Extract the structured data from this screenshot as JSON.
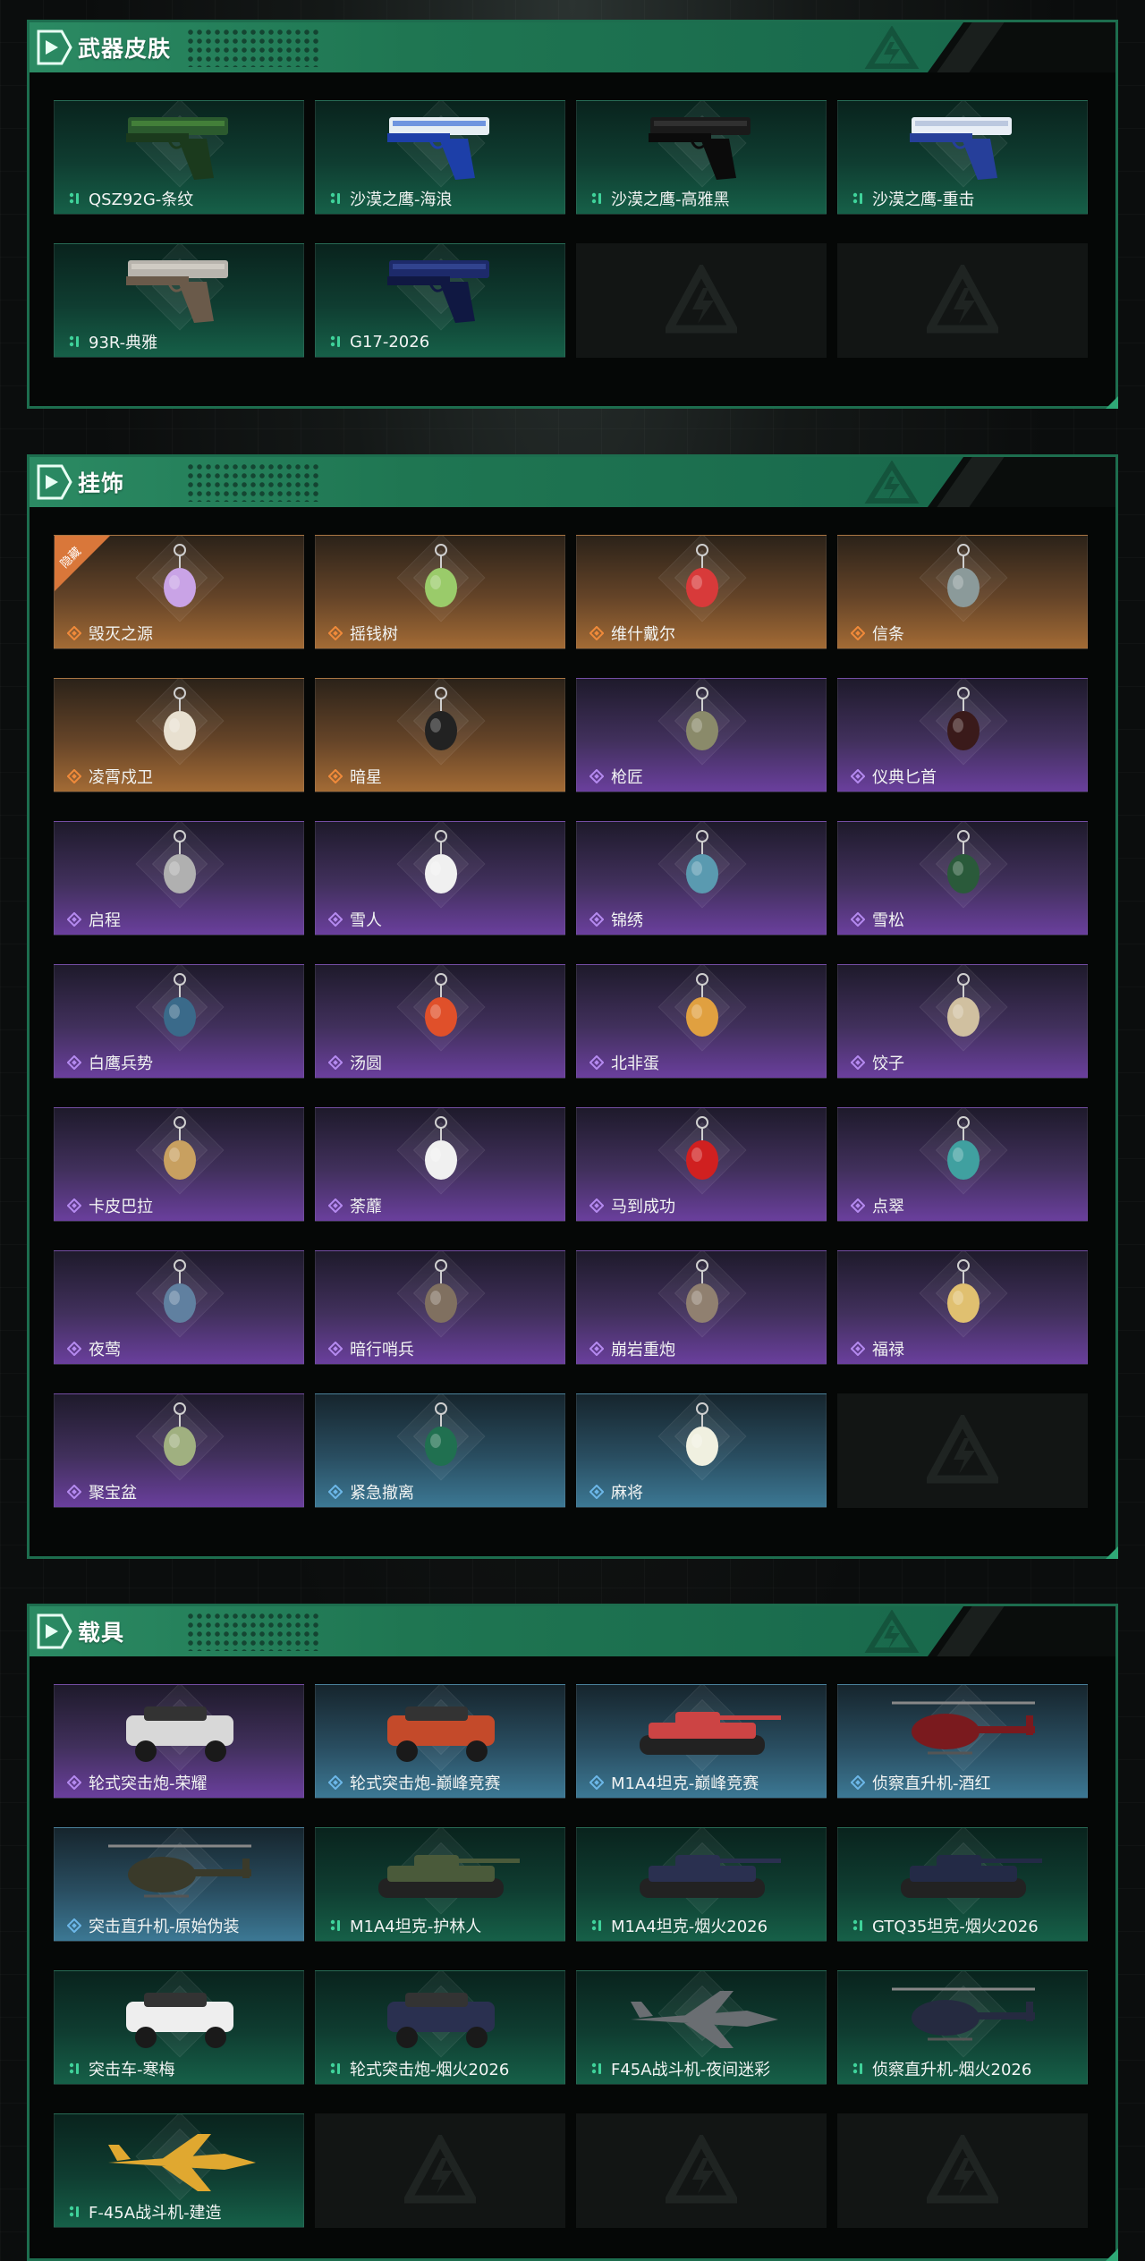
{
  "sections": {
    "weapons": {
      "title": "武器皮肤",
      "items": [
        {
          "label": "QSZ92G-条纹",
          "rarity": "green",
          "art": "pistol-green-camo"
        },
        {
          "label": "沙漠之鹰-海浪",
          "rarity": "green",
          "art": "pistol-blue-wave"
        },
        {
          "label": "沙漠之鹰-高雅黑",
          "rarity": "green",
          "art": "pistol-black"
        },
        {
          "label": "沙漠之鹰-重击",
          "rarity": "green",
          "art": "pistol-white-blue"
        },
        {
          "label": "93R-典雅",
          "rarity": "green",
          "art": "pistol-silver"
        },
        {
          "label": "G17-2026",
          "rarity": "green",
          "art": "pistol-navy"
        }
      ]
    },
    "charms": {
      "title": "挂饰",
      "hidden_badge": "隐藏",
      "items": [
        {
          "label": "毁灭之源",
          "rarity": "orange"
        },
        {
          "label": "摇钱树",
          "rarity": "orange"
        },
        {
          "label": "维什戴尔",
          "rarity": "orange"
        },
        {
          "label": "信条",
          "rarity": "orange"
        },
        {
          "label": "凌霄戍卫",
          "rarity": "orange"
        },
        {
          "label": "暗星",
          "rarity": "orange"
        },
        {
          "label": "枪匠",
          "rarity": "purple"
        },
        {
          "label": "仪典匕首",
          "rarity": "purple"
        },
        {
          "label": "启程",
          "rarity": "purple"
        },
        {
          "label": "雪人",
          "rarity": "purple"
        },
        {
          "label": "锦绣",
          "rarity": "purple"
        },
        {
          "label": "雪松",
          "rarity": "purple"
        },
        {
          "label": "白鹰兵势",
          "rarity": "purple"
        },
        {
          "label": "汤圆",
          "rarity": "purple"
        },
        {
          "label": "北非蛋",
          "rarity": "purple"
        },
        {
          "label": "饺子",
          "rarity": "purple"
        },
        {
          "label": "卡皮巴拉",
          "rarity": "purple"
        },
        {
          "label": "荼蘼",
          "rarity": "purple"
        },
        {
          "label": "马到成功",
          "rarity": "purple"
        },
        {
          "label": "点翠",
          "rarity": "purple"
        },
        {
          "label": "夜莺",
          "rarity": "purple"
        },
        {
          "label": "暗行哨兵",
          "rarity": "purple"
        },
        {
          "label": "崩岩重炮",
          "rarity": "purple"
        },
        {
          "label": "福禄",
          "rarity": "purple"
        },
        {
          "label": "聚宝盆",
          "rarity": "purple"
        },
        {
          "label": "紧急撤离",
          "rarity": "blue"
        },
        {
          "label": "麻将",
          "rarity": "blue"
        }
      ]
    },
    "vehicles": {
      "title": "载具",
      "items": [
        {
          "label": "轮式突击炮-荣耀",
          "rarity": "purple",
          "art": "buggy"
        },
        {
          "label": "轮式突击炮-巅峰竞赛",
          "rarity": "blue",
          "art": "buggy-red"
        },
        {
          "label": "M1A4坦克-巅峰竞赛",
          "rarity": "blue",
          "art": "tank-red"
        },
        {
          "label": "侦察直升机-酒红",
          "rarity": "blue",
          "art": "heli-red"
        },
        {
          "label": "突击直升机-原始伪装",
          "rarity": "blue",
          "art": "attack-heli"
        },
        {
          "label": "M1A4坦克-护林人",
          "rarity": "green",
          "art": "tank-green"
        },
        {
          "label": "M1A4坦克-烟火2026",
          "rarity": "green",
          "art": "tank-navy"
        },
        {
          "label": "GTQ35坦克-烟火2026",
          "rarity": "green",
          "art": "tank-navy2"
        },
        {
          "label": "突击车-寒梅",
          "rarity": "green",
          "art": "apc-white"
        },
        {
          "label": "轮式突击炮-烟火2026",
          "rarity": "green",
          "art": "buggy-navy"
        },
        {
          "label": "F45A战斗机-夜间迷彩",
          "rarity": "green",
          "art": "jet-grey"
        },
        {
          "label": "侦察直升机-烟火2026",
          "rarity": "green",
          "art": "heli-navy"
        },
        {
          "label": "F-45A战斗机-建造",
          "rarity": "green",
          "art": "jet-yellow"
        }
      ]
    }
  },
  "colors": {
    "accent": "#2b8a63",
    "green_rarity": "#3fd29a",
    "orange_rarity": "#f08a3a",
    "purple_rarity": "#b58af0",
    "blue_rarity": "#6cb7e8"
  }
}
